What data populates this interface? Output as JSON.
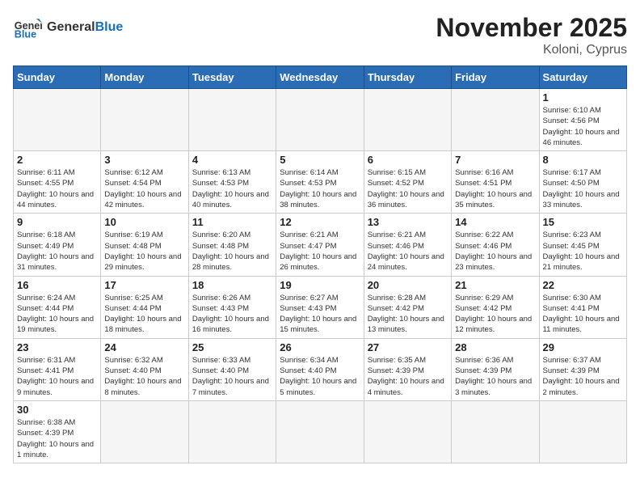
{
  "header": {
    "logo_general": "General",
    "logo_blue": "Blue",
    "month_title": "November 2025",
    "location": "Koloni, Cyprus"
  },
  "weekdays": [
    "Sunday",
    "Monday",
    "Tuesday",
    "Wednesday",
    "Thursday",
    "Friday",
    "Saturday"
  ],
  "weeks": [
    [
      {
        "day": "",
        "info": ""
      },
      {
        "day": "",
        "info": ""
      },
      {
        "day": "",
        "info": ""
      },
      {
        "day": "",
        "info": ""
      },
      {
        "day": "",
        "info": ""
      },
      {
        "day": "",
        "info": ""
      },
      {
        "day": "1",
        "info": "Sunrise: 6:10 AM\nSunset: 4:56 PM\nDaylight: 10 hours and 46 minutes."
      }
    ],
    [
      {
        "day": "2",
        "info": "Sunrise: 6:11 AM\nSunset: 4:55 PM\nDaylight: 10 hours and 44 minutes."
      },
      {
        "day": "3",
        "info": "Sunrise: 6:12 AM\nSunset: 4:54 PM\nDaylight: 10 hours and 42 minutes."
      },
      {
        "day": "4",
        "info": "Sunrise: 6:13 AM\nSunset: 4:53 PM\nDaylight: 10 hours and 40 minutes."
      },
      {
        "day": "5",
        "info": "Sunrise: 6:14 AM\nSunset: 4:53 PM\nDaylight: 10 hours and 38 minutes."
      },
      {
        "day": "6",
        "info": "Sunrise: 6:15 AM\nSunset: 4:52 PM\nDaylight: 10 hours and 36 minutes."
      },
      {
        "day": "7",
        "info": "Sunrise: 6:16 AM\nSunset: 4:51 PM\nDaylight: 10 hours and 35 minutes."
      },
      {
        "day": "8",
        "info": "Sunrise: 6:17 AM\nSunset: 4:50 PM\nDaylight: 10 hours and 33 minutes."
      }
    ],
    [
      {
        "day": "9",
        "info": "Sunrise: 6:18 AM\nSunset: 4:49 PM\nDaylight: 10 hours and 31 minutes."
      },
      {
        "day": "10",
        "info": "Sunrise: 6:19 AM\nSunset: 4:48 PM\nDaylight: 10 hours and 29 minutes."
      },
      {
        "day": "11",
        "info": "Sunrise: 6:20 AM\nSunset: 4:48 PM\nDaylight: 10 hours and 28 minutes."
      },
      {
        "day": "12",
        "info": "Sunrise: 6:21 AM\nSunset: 4:47 PM\nDaylight: 10 hours and 26 minutes."
      },
      {
        "day": "13",
        "info": "Sunrise: 6:21 AM\nSunset: 4:46 PM\nDaylight: 10 hours and 24 minutes."
      },
      {
        "day": "14",
        "info": "Sunrise: 6:22 AM\nSunset: 4:46 PM\nDaylight: 10 hours and 23 minutes."
      },
      {
        "day": "15",
        "info": "Sunrise: 6:23 AM\nSunset: 4:45 PM\nDaylight: 10 hours and 21 minutes."
      }
    ],
    [
      {
        "day": "16",
        "info": "Sunrise: 6:24 AM\nSunset: 4:44 PM\nDaylight: 10 hours and 19 minutes."
      },
      {
        "day": "17",
        "info": "Sunrise: 6:25 AM\nSunset: 4:44 PM\nDaylight: 10 hours and 18 minutes."
      },
      {
        "day": "18",
        "info": "Sunrise: 6:26 AM\nSunset: 4:43 PM\nDaylight: 10 hours and 16 minutes."
      },
      {
        "day": "19",
        "info": "Sunrise: 6:27 AM\nSunset: 4:43 PM\nDaylight: 10 hours and 15 minutes."
      },
      {
        "day": "20",
        "info": "Sunrise: 6:28 AM\nSunset: 4:42 PM\nDaylight: 10 hours and 13 minutes."
      },
      {
        "day": "21",
        "info": "Sunrise: 6:29 AM\nSunset: 4:42 PM\nDaylight: 10 hours and 12 minutes."
      },
      {
        "day": "22",
        "info": "Sunrise: 6:30 AM\nSunset: 4:41 PM\nDaylight: 10 hours and 11 minutes."
      }
    ],
    [
      {
        "day": "23",
        "info": "Sunrise: 6:31 AM\nSunset: 4:41 PM\nDaylight: 10 hours and 9 minutes."
      },
      {
        "day": "24",
        "info": "Sunrise: 6:32 AM\nSunset: 4:40 PM\nDaylight: 10 hours and 8 minutes."
      },
      {
        "day": "25",
        "info": "Sunrise: 6:33 AM\nSunset: 4:40 PM\nDaylight: 10 hours and 7 minutes."
      },
      {
        "day": "26",
        "info": "Sunrise: 6:34 AM\nSunset: 4:40 PM\nDaylight: 10 hours and 5 minutes."
      },
      {
        "day": "27",
        "info": "Sunrise: 6:35 AM\nSunset: 4:39 PM\nDaylight: 10 hours and 4 minutes."
      },
      {
        "day": "28",
        "info": "Sunrise: 6:36 AM\nSunset: 4:39 PM\nDaylight: 10 hours and 3 minutes."
      },
      {
        "day": "29",
        "info": "Sunrise: 6:37 AM\nSunset: 4:39 PM\nDaylight: 10 hours and 2 minutes."
      }
    ],
    [
      {
        "day": "30",
        "info": "Sunrise: 6:38 AM\nSunset: 4:39 PM\nDaylight: 10 hours and 1 minute."
      },
      {
        "day": "",
        "info": ""
      },
      {
        "day": "",
        "info": ""
      },
      {
        "day": "",
        "info": ""
      },
      {
        "day": "",
        "info": ""
      },
      {
        "day": "",
        "info": ""
      },
      {
        "day": "",
        "info": ""
      }
    ]
  ]
}
